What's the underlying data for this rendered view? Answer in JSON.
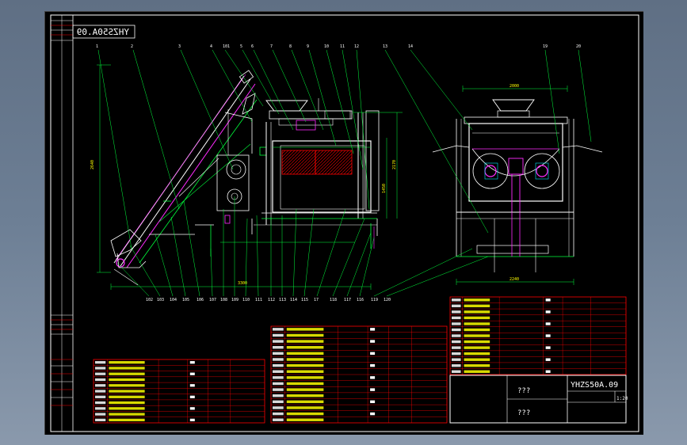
{
  "drawing": {
    "code_top": "YHZS50A.09",
    "code_title": "YHZS50A.09",
    "scale": "1:20",
    "name_placeholder_1": "???",
    "name_placeholder_2": "???"
  },
  "balloons": {
    "top": [
      "1",
      "2",
      "3",
      "4",
      "101",
      "5",
      "6",
      "7",
      "8",
      "9",
      "10",
      "11",
      "12",
      "13",
      "14",
      "19",
      "20"
    ],
    "bottom": [
      "102",
      "103",
      "104",
      "105",
      "106",
      "107",
      "108",
      "109",
      "110",
      "111",
      "112",
      "113",
      "114",
      "115",
      "17",
      "118",
      "117",
      "116",
      "119",
      "120"
    ]
  },
  "dims": {
    "front_width": "3300",
    "front_height": "2640",
    "side_top": "2000",
    "side_bottom": "2240",
    "mid_h1": "2170",
    "mid_h2": "1450"
  },
  "colors": {
    "frame": "#ffffff",
    "outline": "#ffffff",
    "green": "#00ff3c",
    "magenta": "#ff2bff",
    "yellow": "#ffff00",
    "red": "#ff0000",
    "cyan": "#00e5ff"
  }
}
